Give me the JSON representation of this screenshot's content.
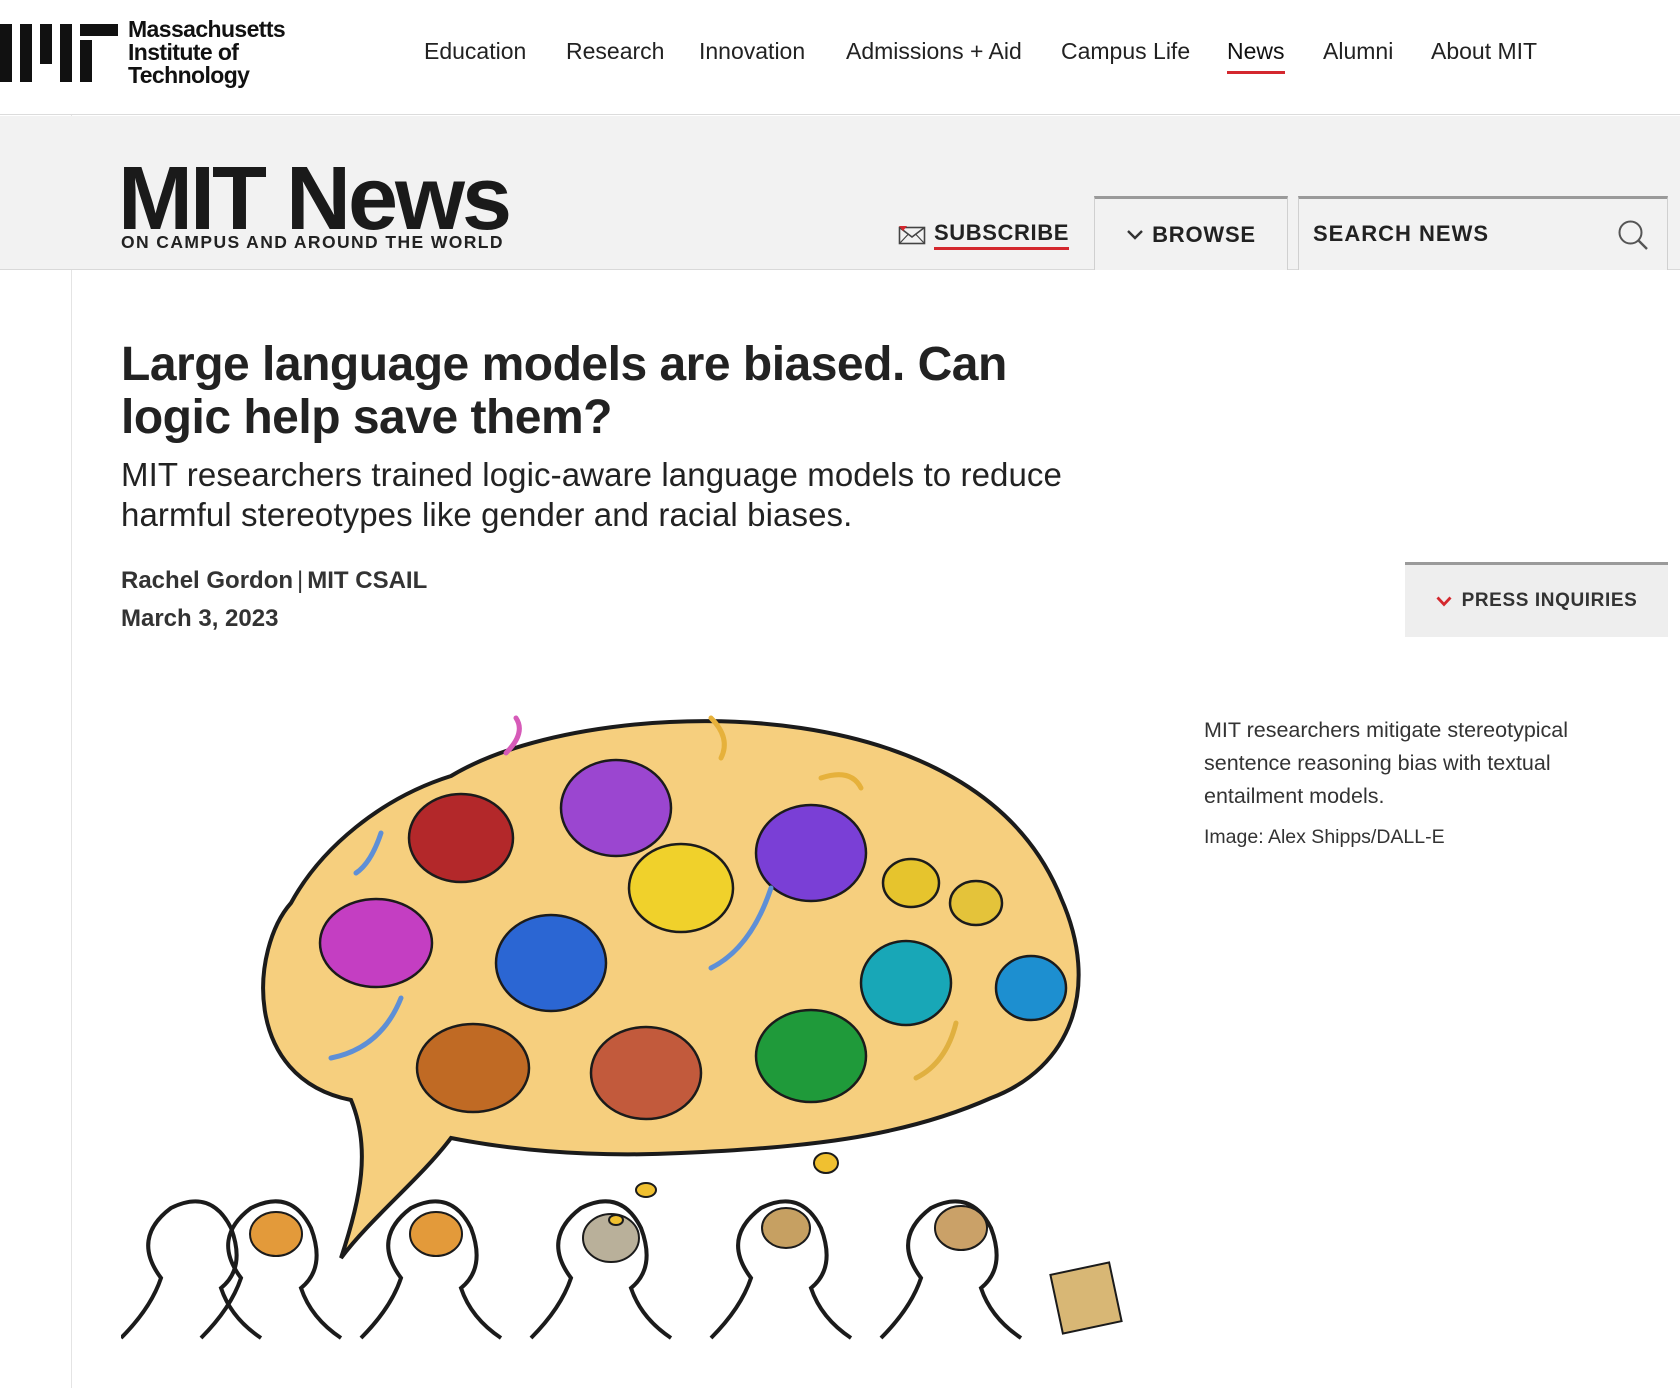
{
  "institute": {
    "name_lines": [
      "Massachusetts",
      "Institute of",
      "Technology"
    ],
    "logo_icon": "mit-logo"
  },
  "nav": {
    "items": [
      {
        "label": "Education"
      },
      {
        "label": "Research"
      },
      {
        "label": "Innovation"
      },
      {
        "label": "Admissions + Aid"
      },
      {
        "label": "Campus Life"
      },
      {
        "label": "News",
        "active": true
      },
      {
        "label": "Alumni"
      },
      {
        "label": "About MIT"
      }
    ]
  },
  "news_header": {
    "title": "MIT News",
    "tagline": "ON CAMPUS AND AROUND THE WORLD",
    "subscribe_label": "SUBSCRIBE",
    "subscribe_icon": "envelope-icon",
    "browse_label": "BROWSE",
    "browse_icon": "chevron-down-icon",
    "search_placeholder": "SEARCH NEWS",
    "search_icon": "search-icon"
  },
  "article": {
    "headline": "Large language models are biased. Can logic help save them?",
    "dek": "MIT researchers trained logic-aware language models to reduce harmful stereotypes like gender and racial biases.",
    "author": "Rachel Gordon",
    "affiliation": "MIT CSAIL",
    "date": "March 3, 2023",
    "press_label": "PRESS INQUIRIES",
    "caption": "MIT researchers mitigate stereotypical sentence reasoning bias with textual entailment models.",
    "credit": "Image: Alex Shipps/DALL-E"
  },
  "colors": {
    "accent_red": "#d4282e",
    "text": "#222222",
    "band_bg": "#f2f2f2",
    "bubble_fill": "#f6cf7e"
  }
}
